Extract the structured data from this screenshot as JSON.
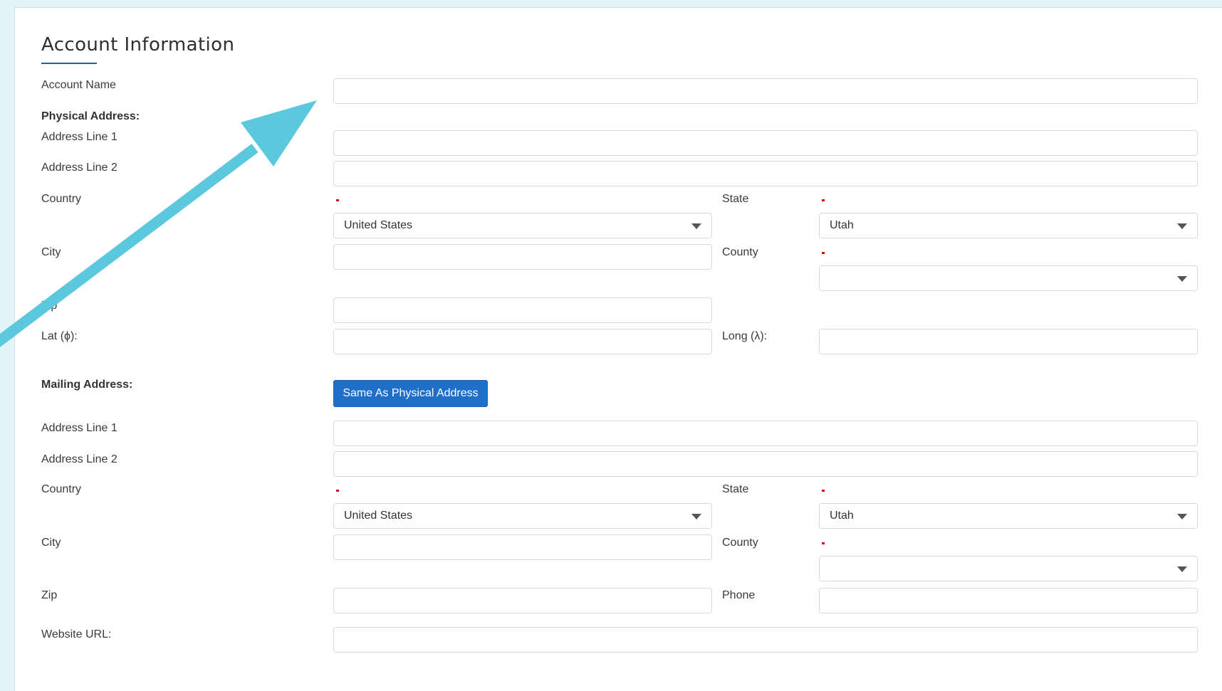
{
  "section": {
    "title": "Account Information"
  },
  "labels": {
    "account_name": "Account Name",
    "physical_address": "Physical Address:",
    "address_line_1": "Address Line 1",
    "address_line_2": "Address Line 2",
    "country": "Country",
    "state": "State",
    "city": "City",
    "county": "County",
    "zip": "Zip",
    "lat": "Lat (ϕ):",
    "long": "Long (λ):",
    "mailing_address": "Mailing Address:",
    "phone": "Phone",
    "website_url": "Website URL:"
  },
  "physical": {
    "account_name": "",
    "address_line_1": "",
    "address_line_2": "",
    "country": "United States",
    "state": "Utah",
    "city": "",
    "county": "",
    "zip": "",
    "lat": "",
    "long": ""
  },
  "mailing": {
    "same_as_physical_label": "Same As Physical Address",
    "address_line_1": "",
    "address_line_2": "",
    "country": "United States",
    "state": "Utah",
    "city": "",
    "county": "",
    "zip": "",
    "phone": "",
    "website_url": ""
  },
  "colors": {
    "accent_button": "#1f6fc9",
    "annotation_arrow": "#5bc8de",
    "required_marker": "#d0021b",
    "background": "#e3f3f9"
  },
  "icons": {
    "dropdown": "chevron-down-icon",
    "annotation": "arrow-annotation-icon"
  }
}
